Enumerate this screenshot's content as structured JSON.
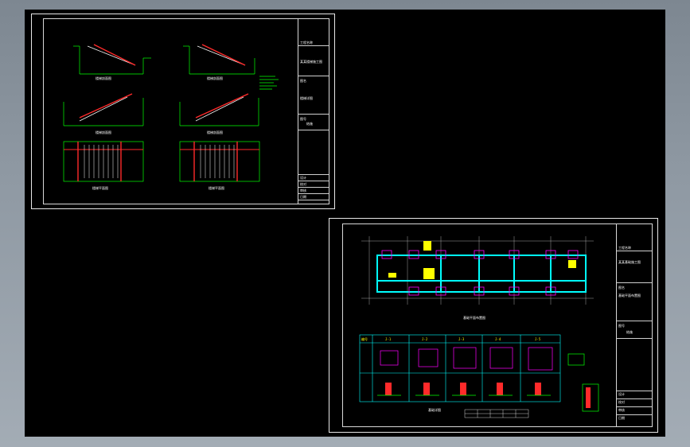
{
  "app": {
    "viewport_bg": "#000000",
    "window_bg": "#8f99a3"
  },
  "colors": {
    "frame": "#e8e8e8",
    "green": "#00ff00",
    "red": "#ff2a2a",
    "magenta": "#ff00ff",
    "yellow": "#ffff00",
    "cyan": "#00ffff",
    "white": "#ffffff"
  },
  "sheet1": {
    "title_block": {
      "rows": [
        {
          "text": "工程名称"
        },
        {
          "text": "某某楼梯施工图"
        },
        {
          "text": "图名"
        },
        {
          "text": "楼梯详图"
        },
        {
          "text": "图号"
        },
        {
          "text": "结施"
        },
        {
          "text": "设计"
        },
        {
          "text": "校对"
        },
        {
          "text": "审核"
        },
        {
          "text": "日期"
        }
      ]
    },
    "view_labels": [
      "楼梯剖面图",
      "楼梯剖面图",
      "楼梯剖面图",
      "楼梯剖面图",
      "楼梯平面图",
      "楼梯平面图"
    ]
  },
  "sheet2": {
    "title_block": {
      "rows": [
        {
          "text": "工程名称"
        },
        {
          "text": "某某基础施工图"
        },
        {
          "text": "图名"
        },
        {
          "text": "基础平面布置图"
        },
        {
          "text": "图号"
        },
        {
          "text": "结施"
        },
        {
          "text": "设计"
        },
        {
          "text": "校对"
        },
        {
          "text": "审核"
        },
        {
          "text": "日期"
        }
      ]
    },
    "plan_label": "基础平面布置图",
    "detail_label": "基础详图",
    "table_headers": [
      "编号",
      "J-1",
      "J-2",
      "J-3",
      "J-4",
      "J-5"
    ]
  }
}
